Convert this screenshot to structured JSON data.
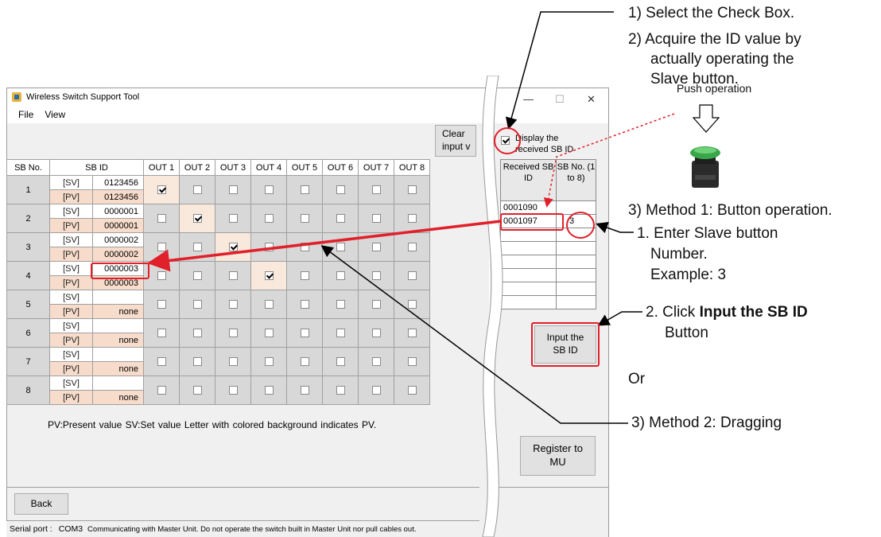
{
  "window": {
    "title": "Wireless Switch Support Tool",
    "menu": [
      "File",
      "View"
    ],
    "controls": {
      "minimize": "—",
      "maximize": "☐",
      "close": "✕"
    }
  },
  "grid": {
    "headers": [
      "SB No.",
      "SB ID",
      "OUT 1",
      "OUT 2",
      "OUT 3",
      "OUT 4",
      "OUT 5",
      "OUT 6",
      "OUT 7",
      "OUT 8"
    ],
    "rows": [
      {
        "no": "1",
        "sv": "0123456",
        "pv": "0123456",
        "checked": 1
      },
      {
        "no": "2",
        "sv": "0000001",
        "pv": "0000001",
        "checked": 2
      },
      {
        "no": "3",
        "sv": "0000002",
        "pv": "0000002",
        "checked": 3
      },
      {
        "no": "4",
        "sv": "0000003",
        "pv": "0000003",
        "checked": 4
      },
      {
        "no": "5",
        "sv": "",
        "pv": "none",
        "checked": 0
      },
      {
        "no": "6",
        "sv": "",
        "pv": "none",
        "checked": 0
      },
      {
        "no": "7",
        "sv": "",
        "pv": "none",
        "checked": 0
      },
      {
        "no": "8",
        "sv": "",
        "pv": "none",
        "checked": 0
      }
    ],
    "sv_tag": "[SV]",
    "pv_tag": "[PV]"
  },
  "legend": "PV:Present value  SV:Set value    Letter with colored background indicates PV.",
  "clear_button": "Clear input v",
  "display_checkbox": {
    "label_line1": "Display the",
    "label_line2": "received SB ID",
    "checked": true
  },
  "received": {
    "header_id": "Received SB ID",
    "header_no": "SB No. (1 to 8)",
    "rows": [
      {
        "id": "0001090",
        "no": ""
      },
      {
        "id": "0001097",
        "no": "3"
      },
      {
        "id": "",
        "no": ""
      },
      {
        "id": "",
        "no": ""
      },
      {
        "id": "",
        "no": ""
      },
      {
        "id": "",
        "no": ""
      },
      {
        "id": "",
        "no": ""
      },
      {
        "id": "",
        "no": ""
      }
    ]
  },
  "input_sbid_button": "Input the SB ID",
  "register_button": "Register to MU",
  "back_button": "Back",
  "status": {
    "label": "Serial port :",
    "port": "COM3",
    "message": "Communicating with Master Unit. Do not operate the switch built in Master Unit nor pull cables out."
  },
  "annotations": {
    "step1": "1) Select the Check Box.",
    "step2_l1": "2) Acquire the ID value by",
    "step2_l2": "actually operating the",
    "step2_l3": "Slave button.",
    "push_operation": "Push operation",
    "method1": "3) Method 1: Button operation.",
    "method1_s1_l1": "1. Enter Slave button",
    "method1_s1_l2": "Number.",
    "method1_s1_l3": "Example: 3",
    "method1_s2_prefix": "2. Click ",
    "method1_s2_bold": "Input the SB ID",
    "method1_s2_l2": "Button",
    "or": "Or",
    "method2": "3) Method 2: Dragging"
  },
  "colors": {
    "pv_bg": "#f7dccb",
    "annotation_red": "#e0202a",
    "button_green": "#3aa64a"
  }
}
